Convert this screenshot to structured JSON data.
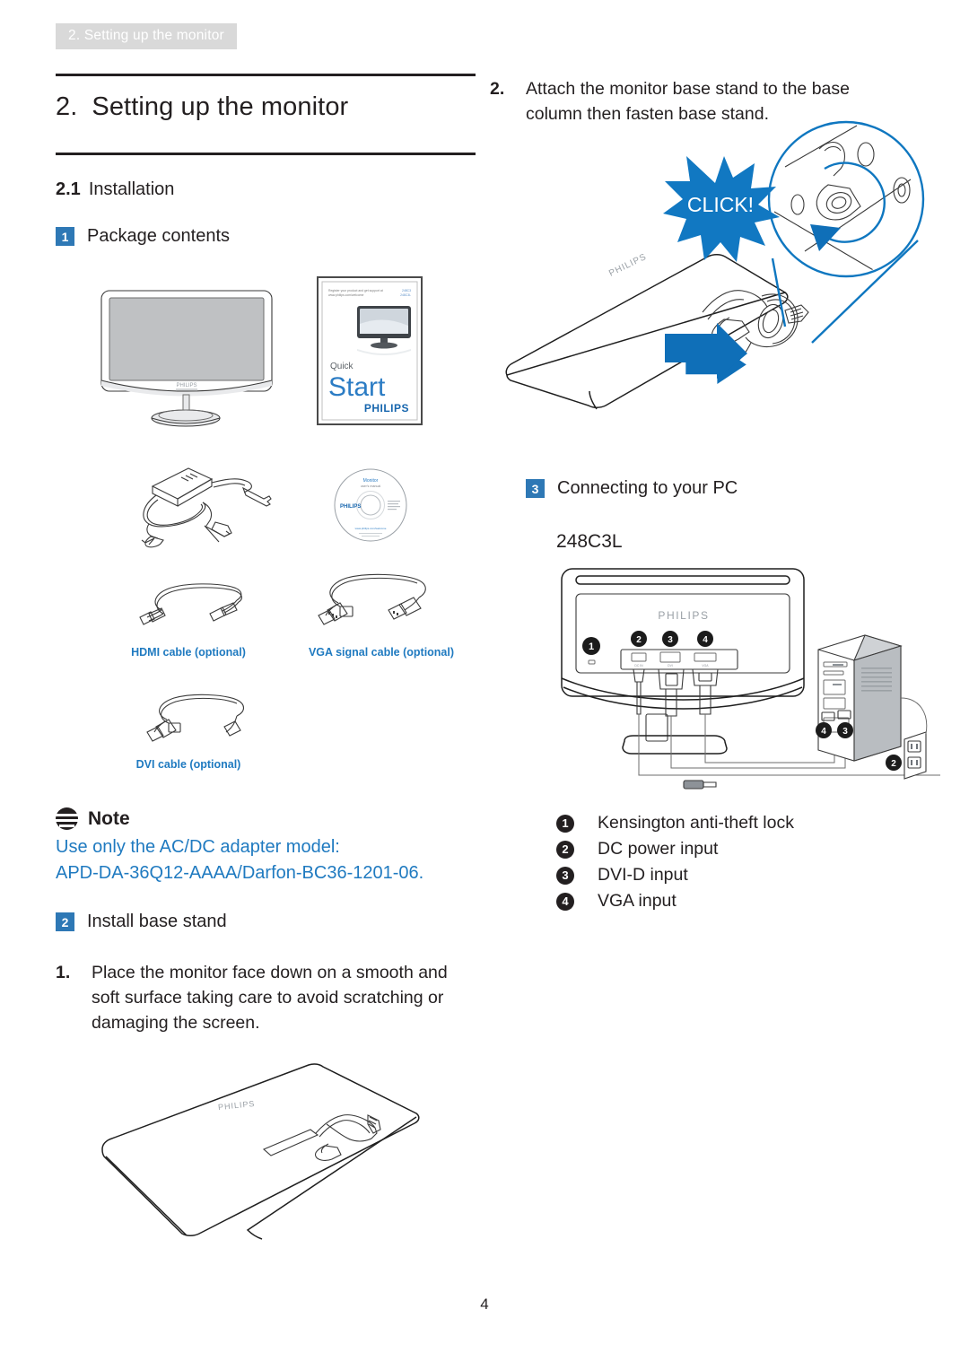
{
  "header": {
    "running_title": "2. Setting up the monitor"
  },
  "title": {
    "number": "2.",
    "text": "Setting up the monitor"
  },
  "section": {
    "number": "2.1",
    "text": "Installation"
  },
  "blocks": {
    "package_contents": {
      "badge": "1",
      "label": "Package contents"
    },
    "install_base_stand": {
      "badge": "2",
      "label": "Install base stand"
    },
    "connecting_pc": {
      "badge": "3",
      "label": "Connecting to your PC"
    }
  },
  "model": "248C3L",
  "captions": {
    "hdmi": "HDMI cable (optional)",
    "vga": "VGA signal cable (optional)",
    "dvi": "DVI cable (optional)"
  },
  "quick_start": {
    "line1": "Register your product and get support at",
    "line2": "www.philips.com/welcome",
    "model_code_1": "248C3",
    "model_code_2": "248C3L",
    "quick": "Quick",
    "start": "Start",
    "brand": "PHILIPS"
  },
  "cd": {
    "line1": "Monitor",
    "line2": "user's manual",
    "brand": "PHILIPS",
    "url": "www.philips.com/welcome"
  },
  "monitor_brand": "PHILIPS",
  "note": {
    "title": "Note",
    "line1": "Use only the AC/DC adapter model:",
    "line2": "APD-DA-36Q12-AAAA/Darfon-BC36-1201-06."
  },
  "steps": {
    "step1": {
      "marker": "1.",
      "text": "Place the monitor face down on a smooth and soft surface taking care to avoid scratching or damaging the screen."
    },
    "step2": {
      "marker": "2.",
      "text": "Attach the monitor base stand to the base column then fasten base stand."
    }
  },
  "click_badge": "CLICK!",
  "port_legend": [
    {
      "num": "1",
      "label": "Kensington anti-theft lock"
    },
    {
      "num": "2",
      "label": "DC power input"
    },
    {
      "num": "3",
      "label": "DVI-D input"
    },
    {
      "num": "4",
      "label": "VGA input"
    }
  ],
  "diagram_callouts": {
    "monitor_rear": [
      "1",
      "2",
      "3",
      "4"
    ],
    "pc_tower": [
      "3",
      "4"
    ],
    "wall_outlet": [
      "2"
    ]
  },
  "page_number": "4",
  "colors": {
    "accent_blue": "#2e78b5",
    "caption_blue": "#1f7ac0",
    "line_blue": "#0f77c0",
    "runhead_bg": "#d9d9d9",
    "ink": "#231f20"
  }
}
